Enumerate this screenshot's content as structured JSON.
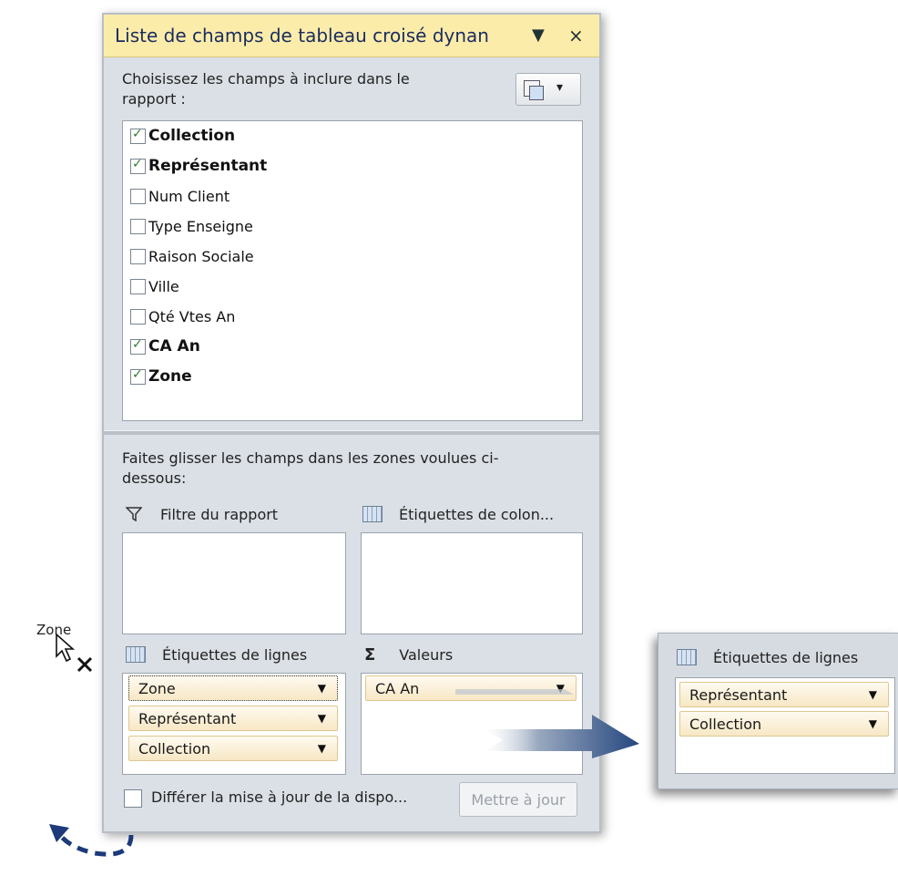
{
  "pane": {
    "title": "Liste de champs de tableau croisé dynan",
    "title_dropdown": "▼",
    "title_close": "×",
    "choose_label": "Choisissez les champs à inclure dans le rapport :",
    "layout_chevron": "▾",
    "fields": [
      {
        "label": "Collection",
        "checked": true
      },
      {
        "label": "Représentant",
        "checked": true
      },
      {
        "label": "Num Client",
        "checked": false
      },
      {
        "label": "Type Enseigne",
        "checked": false
      },
      {
        "label": "Raison Sociale",
        "checked": false
      },
      {
        "label": "Ville",
        "checked": false
      },
      {
        "label": "Qté Vtes An",
        "checked": false
      },
      {
        "label": "CA An",
        "checked": true
      },
      {
        "label": "Zone",
        "checked": true
      }
    ],
    "drag_label": "Faites glisser les champs dans les zones voulues ci-dessous:",
    "zones": {
      "filter": {
        "title": "Filtre du rapport",
        "icon": "filter-icon"
      },
      "columns": {
        "title": "Étiquettes de colon...",
        "icon": "grid-icon"
      },
      "rows": {
        "title": "Étiquettes de lignes",
        "icon": "grid-icon",
        "items": [
          "Zone",
          "Représentant",
          "Collection"
        ]
      },
      "values": {
        "title": "Valeurs",
        "icon": "sigma-icon",
        "sigma": "Σ",
        "items": [
          "CA An"
        ]
      }
    },
    "defer_label": "Différer la mise à jour de la dispo...",
    "update_label": "Mettre à jour"
  },
  "drag_ghost": {
    "label": "Zone",
    "remove_mark": "×"
  },
  "zoom_panel": {
    "title": "Étiquettes de lignes",
    "items": [
      "Représentant",
      "Collection"
    ]
  },
  "colors": {
    "title_bar": "#fcecaa",
    "pane_bg": "#dbe0e6",
    "arrow_blue": "#2c4f8a",
    "pill": "#f7e7c4"
  }
}
